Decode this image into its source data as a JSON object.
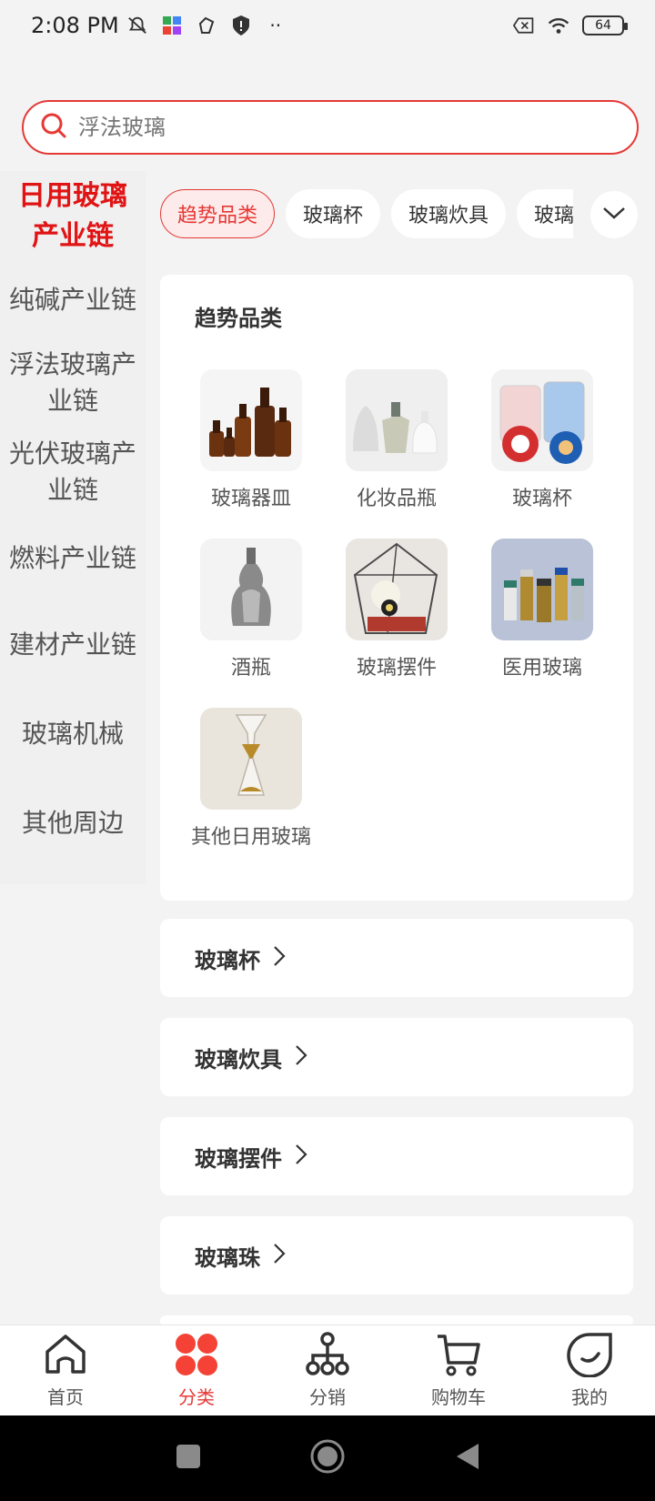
{
  "status": {
    "time": "2:08 PM",
    "battery": "64"
  },
  "search": {
    "placeholder": "浮法玻璃"
  },
  "sidebar": {
    "items": [
      {
        "label": "日用玻璃产业链",
        "active": true
      },
      {
        "label": "纯碱产业链"
      },
      {
        "label": "浮法玻璃产业链"
      },
      {
        "label": "光伏玻璃产业链"
      },
      {
        "label": "燃料产业链"
      },
      {
        "label": "建材产业链"
      },
      {
        "label": "玻璃机械"
      },
      {
        "label": "其他周边"
      }
    ]
  },
  "tabs": {
    "items": [
      {
        "label": "趋势品类",
        "active": true
      },
      {
        "label": "玻璃杯"
      },
      {
        "label": "玻璃炊具"
      },
      {
        "label": "玻璃摆"
      }
    ]
  },
  "trend": {
    "title": "趋势品类",
    "items": [
      {
        "label": "玻璃器皿",
        "icon": "amber-bottles-image"
      },
      {
        "label": "化妆品瓶",
        "icon": "cosmetic-bottles-image"
      },
      {
        "label": "玻璃杯",
        "icon": "jar-image"
      },
      {
        "label": "酒瓶",
        "icon": "wine-bottle-image"
      },
      {
        "label": "玻璃摆件",
        "icon": "terrarium-image"
      },
      {
        "label": "医用玻璃",
        "icon": "vials-image"
      },
      {
        "label": "其他日用玻璃",
        "icon": "hourglass-image"
      }
    ]
  },
  "sections": [
    {
      "label": "玻璃杯"
    },
    {
      "label": "玻璃炊具"
    },
    {
      "label": "玻璃摆件"
    },
    {
      "label": "玻璃珠"
    }
  ],
  "bottom_nav": {
    "items": [
      {
        "label": "首页",
        "icon": "home-icon"
      },
      {
        "label": "分类",
        "icon": "category-icon",
        "active": true
      },
      {
        "label": "分销",
        "icon": "distribution-icon"
      },
      {
        "label": "购物车",
        "icon": "cart-icon"
      },
      {
        "label": "我的",
        "icon": "profile-icon"
      }
    ]
  },
  "colors": {
    "accent": "#e53935",
    "active_text": "#e01414"
  }
}
